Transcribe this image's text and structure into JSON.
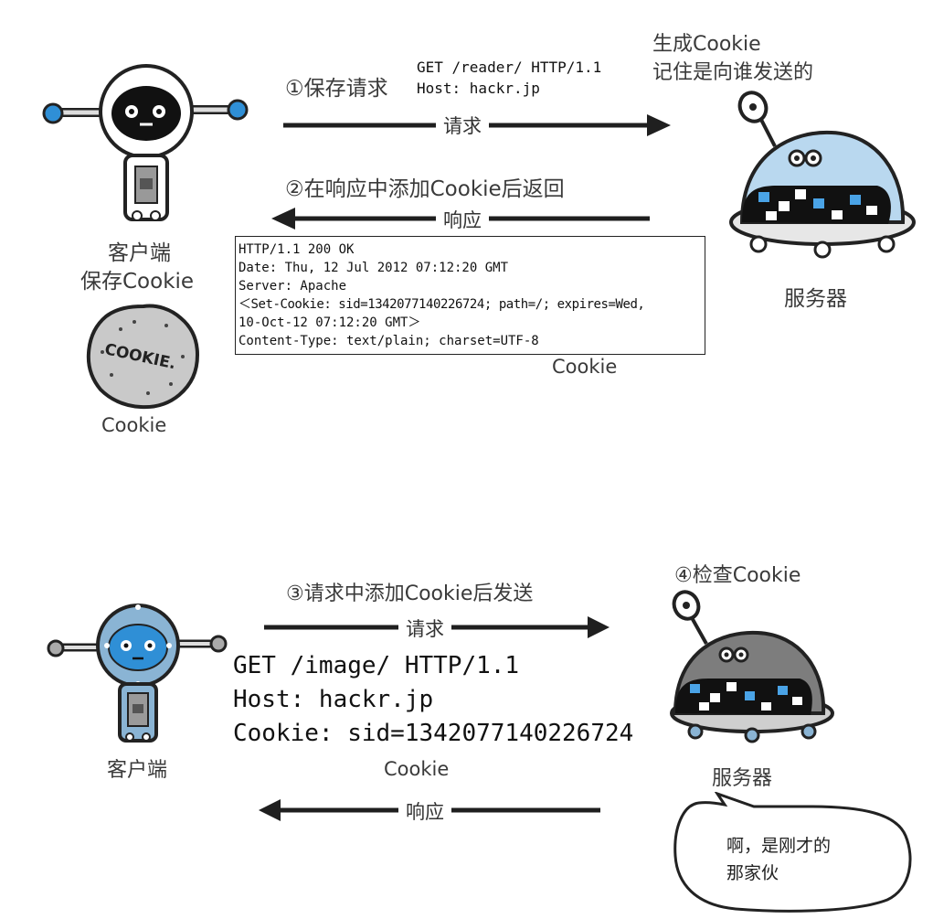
{
  "top": {
    "step1": "①保存请求",
    "request_line1": "GET /reader/ HTTP/1.1",
    "request_line2": "Host: hackr.jp",
    "arrow_request": "请求",
    "server_note_line1": "生成Cookie",
    "server_note_line2": "记住是向谁发送的",
    "step2": "②在响应中添加Cookie后返回",
    "arrow_response": "响应",
    "client_line1": "客户端",
    "client_line2": "保存Cookie",
    "cookie_label": "Cookie",
    "cookie_text_on_biscuit": "COOKIE.",
    "server_label": "服务器",
    "response_cookie_label": "Cookie",
    "response_lines": [
      "HTTP/1.1 200 OK",
      "Date: Thu, 12 Jul 2012 07:12:20 GMT",
      "Server: Apache",
      "＜Set-Cookie: sid=1342077140226724; path=/; expires=Wed,",
      "10-Oct-12 07:12:20 GMT＞",
      "Content-Type: text/plain; charset=UTF-8"
    ]
  },
  "bottom": {
    "step3": "③请求中添加Cookie后发送",
    "arrow_request": "请求",
    "request_lines": [
      "GET /image/ HTTP/1.1",
      "Host: hackr.jp",
      "Cookie: sid=1342077140226724"
    ],
    "cookie_label": "Cookie",
    "step4": "④检查Cookie",
    "client_label": "客户端",
    "server_label": "服务器",
    "arrow_response": "响应",
    "bubble_line1": "啊，是刚才的",
    "bubble_line2": "那家伙"
  },
  "colors": {
    "arrow": "#1f1f1f",
    "robot_outline": "#222222",
    "robot_face_top": "#111111",
    "robot_face_bottom": "#2f8fd6",
    "robot_body_bottom": "#8ab4d4",
    "server_shell": "#b9d8ef",
    "server_screen_accent": "#4aa3e6"
  }
}
